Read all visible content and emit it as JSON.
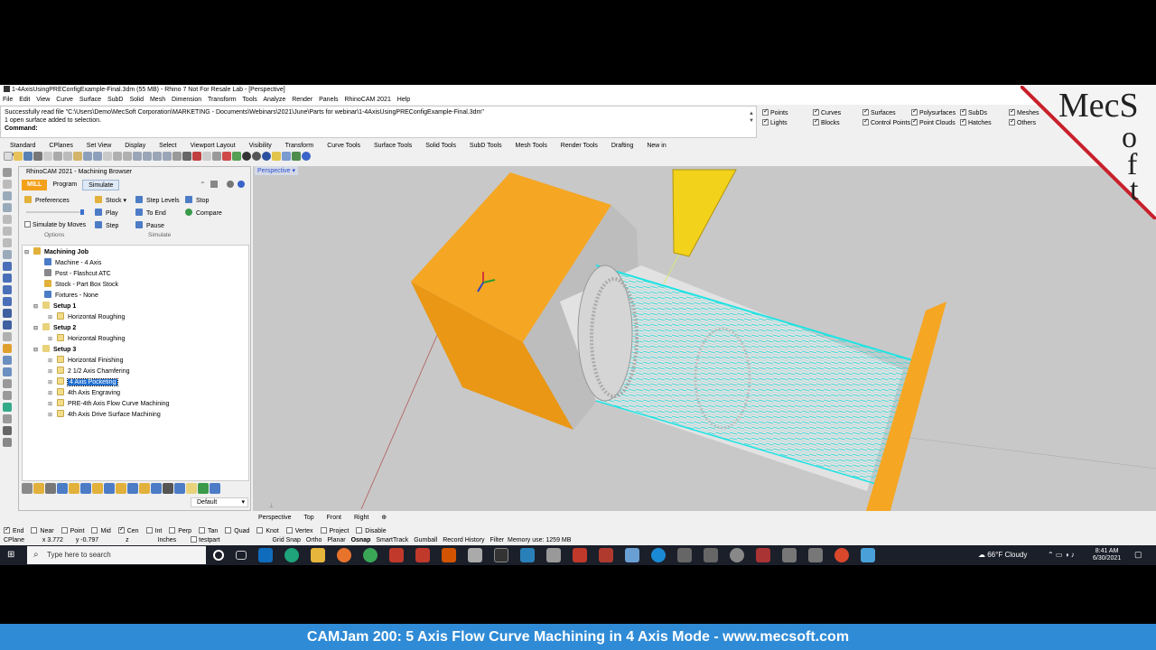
{
  "window": {
    "title": "1-4AxisUsingPREConfigExample-Final.3dm (55 MB) - Rhino 7 Not For Resale Lab - [Perspective]"
  },
  "menu": [
    "File",
    "Edit",
    "View",
    "Curve",
    "Surface",
    "SubD",
    "Solid",
    "Mesh",
    "Dimension",
    "Transform",
    "Tools",
    "Analyze",
    "Render",
    "Panels",
    "RhinoCAM 2021",
    "Help"
  ],
  "command_history": {
    "line1": "Successfully read file \"C:\\Users\\Demo\\MecSoft Corporation\\MARKETING - Documents\\Webinars\\2021\\June\\Parts for webinar\\1-4AxisUsingPREConfigExample-Final.3dm\"",
    "line2": "1 open surface added to selection.",
    "prompt": "Command:"
  },
  "selection_filter": [
    {
      "label": "Points",
      "checked": true
    },
    {
      "label": "Curves",
      "checked": true
    },
    {
      "label": "Surfaces",
      "checked": true
    },
    {
      "label": "Polysurfaces",
      "checked": true
    },
    {
      "label": "SubDs",
      "checked": true
    },
    {
      "label": "Meshes",
      "checked": true
    },
    {
      "label": "Lights",
      "checked": true
    },
    {
      "label": "Blocks",
      "checked": true
    },
    {
      "label": "Control Points",
      "checked": true
    },
    {
      "label": "Point Clouds",
      "checked": true
    },
    {
      "label": "Hatches",
      "checked": true
    },
    {
      "label": "Others",
      "checked": true
    }
  ],
  "toolbar_tabs": [
    "Standard",
    "CPlanes",
    "Set View",
    "Display",
    "Select",
    "Viewport Layout",
    "Visibility",
    "Transform",
    "Curve Tools",
    "Surface Tools",
    "Solid Tools",
    "SubD Tools",
    "Mesh Tools",
    "Render Tools",
    "Drafting",
    "New in V7"
  ],
  "browser": {
    "title": "RhinoCAM 2021 - Machining Browser",
    "tabs": {
      "mill": "MILL",
      "program": "Program",
      "simulate": "Simulate"
    },
    "ribbon": {
      "preferences": "Preferences",
      "simulate_by_moves": "Simulate by Moves",
      "options_group": "Options",
      "stock": "Stock",
      "play": "Play",
      "step": "Step",
      "step_levels": "Step Levels",
      "to_end": "To End",
      "pause": "Pause",
      "stop": "Stop",
      "compare": "Compare",
      "simulate_group": "Simulate"
    },
    "tree": {
      "root": "Machining Job",
      "machine": "Machine - 4 Axis",
      "post": "Post - Flashcut ATC",
      "stock": "Stock - Part Box Stock",
      "fixtures": "Fixtures - None",
      "setup1": "Setup 1",
      "setup1_op1": "Horizontal Roughing",
      "setup2": "Setup 2",
      "setup2_op1": "Horizontal Roughing",
      "setup3": "Setup 3",
      "setup3_ops": [
        "Horizontal Finishing",
        "2 1/2 Axis Chamfering",
        "4 Axis Pocketing",
        "4th Axis Engraving",
        "PRE-4th Axis Flow Curve Machining",
        "4th Axis Drive Surface Machining"
      ]
    },
    "default_dropdown": "Default"
  },
  "viewport": {
    "active_tab": "Perspective",
    "view_tabs": [
      "Perspective",
      "Top",
      "Front",
      "Right"
    ]
  },
  "osnap": [
    {
      "label": "End",
      "checked": true
    },
    {
      "label": "Near",
      "checked": false
    },
    {
      "label": "Point",
      "checked": false
    },
    {
      "label": "Mid",
      "checked": false
    },
    {
      "label": "Cen",
      "checked": true
    },
    {
      "label": "Int",
      "checked": false
    },
    {
      "label": "Perp",
      "checked": false
    },
    {
      "label": "Tan",
      "checked": false
    },
    {
      "label": "Quad",
      "checked": false
    },
    {
      "label": "Knot",
      "checked": false
    },
    {
      "label": "Vertex",
      "checked": false
    },
    {
      "label": "Project",
      "checked": false
    },
    {
      "label": "Disable",
      "checked": false
    }
  ],
  "status": {
    "cplane": "CPlane",
    "x": "x 3.772",
    "y": "y -0.797",
    "z": "z",
    "units": "Inches",
    "layer": "testpart",
    "grid_snap": "Grid Snap",
    "ortho": "Ortho",
    "planar": "Planar",
    "osnap": "Osnap",
    "smarttrack": "SmartTrack",
    "gumball": "Gumball",
    "record_history": "Record History",
    "filter": "Filter",
    "memory": "Memory use: 1259 MB"
  },
  "taskbar": {
    "search_placeholder": "Type here to search",
    "weather": "66°F  Cloudy",
    "time": "8:41 AM",
    "date": "6/30/2021"
  },
  "logo_text": "MecSoft",
  "banner": "CAMJam 200: 5 Axis Flow Curve Machining in 4 Axis Mode - www.mecsoft.com",
  "colors": {
    "accent_orange": "#f4a11a",
    "toolpath_cyan": "#3ee6e6",
    "tool_yellow": "#f2d21b",
    "banner_blue": "#2f8bd6",
    "logo_red": "#c8202a"
  }
}
